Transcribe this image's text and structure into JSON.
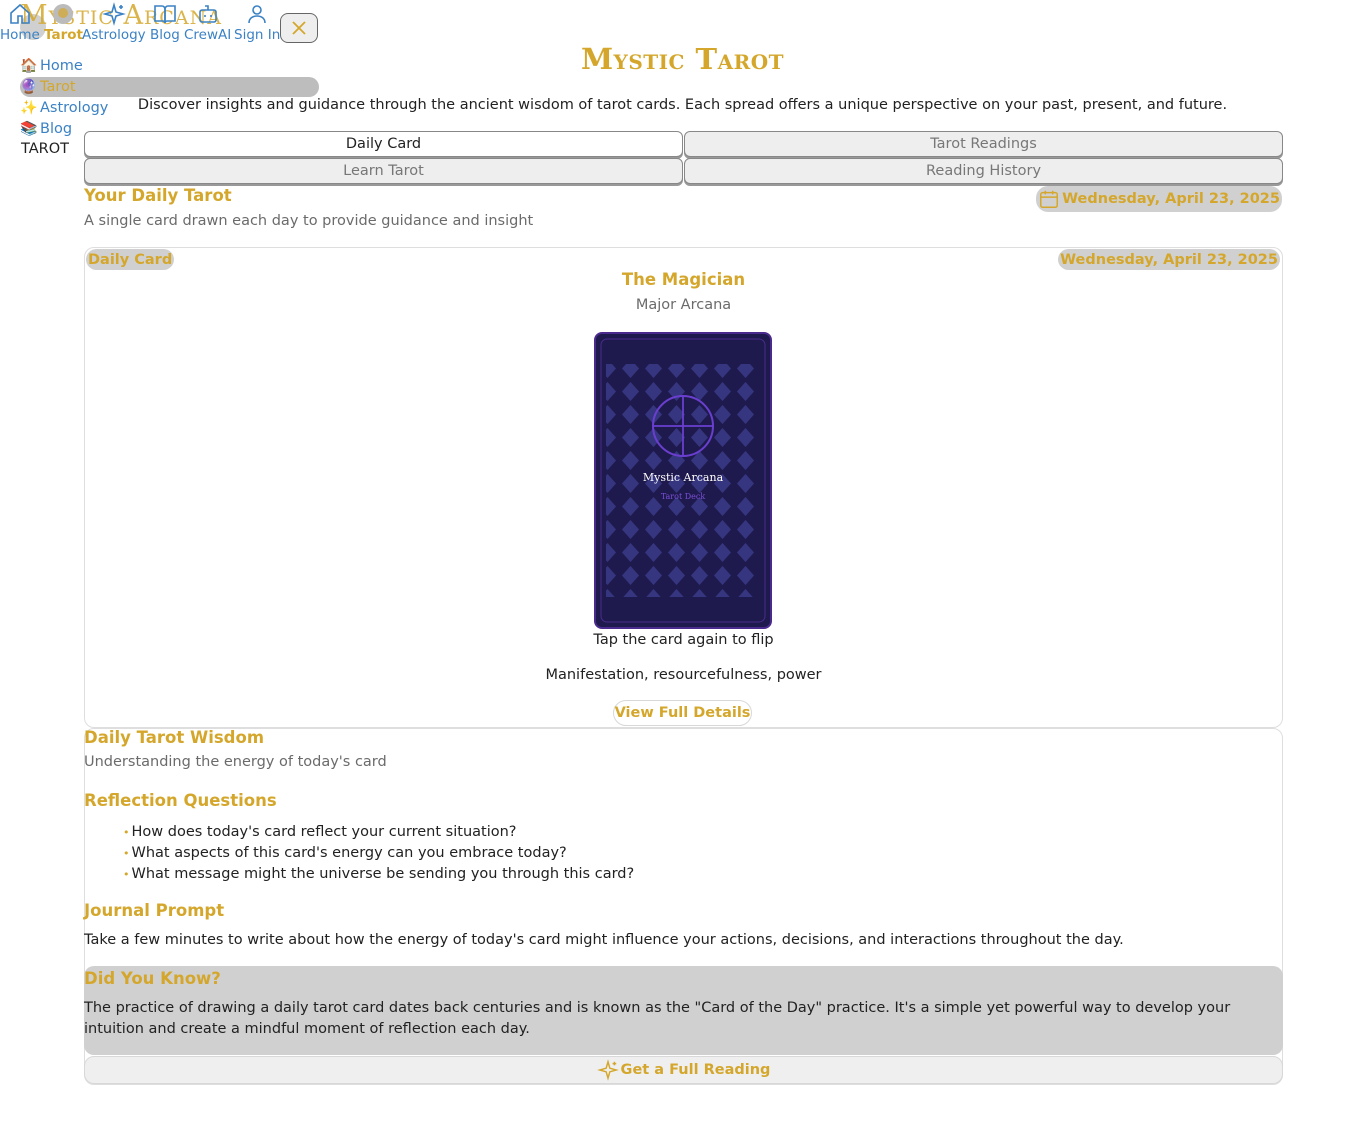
{
  "nav": {
    "logo": "Mystic Arcana",
    "items": [
      {
        "label": "Home",
        "icon": "home-icon"
      },
      {
        "label": "Tarot",
        "icon": "tarot-icon"
      },
      {
        "label": "Astrology",
        "icon": "sparkles-icon"
      },
      {
        "label": "Blog",
        "icon": "book-icon"
      },
      {
        "label": "CrewAI",
        "icon": "bot-icon"
      },
      {
        "label": "Sign In",
        "icon": "user-icon"
      }
    ]
  },
  "sidebar": {
    "items": [
      {
        "label": "Home",
        "emoji": "🏠"
      },
      {
        "label": "Tarot",
        "emoji": "🔮"
      },
      {
        "label": "Astrology",
        "emoji": "✨"
      },
      {
        "label": "Blog",
        "emoji": "📚"
      }
    ],
    "section_label": "TAROT"
  },
  "header": {
    "title": "Mystic Tarot",
    "subtitle": "Discover insights and guidance through the ancient wisdom of tarot cards. Each spread offers a unique perspective on your past, present, and future."
  },
  "tabs": [
    {
      "label": "Daily Card",
      "active": true
    },
    {
      "label": "Tarot Readings",
      "active": false
    },
    {
      "label": "Learn Tarot",
      "active": false
    },
    {
      "label": "Reading History",
      "active": false
    }
  ],
  "daily": {
    "title": "Your Daily Tarot",
    "description": "A single card drawn each day to provide guidance and insight",
    "date": "Wednesday, April 23, 2025",
    "card_pill": "Daily Card",
    "card_date": "Wednesday, April 23, 2025",
    "card_name": "The Magician",
    "card_arcana": "Major Arcana",
    "card_back_title": "Mystic Arcana",
    "card_back_subtitle": "Tarot Deck",
    "tap_hint": "Tap the card again to flip",
    "keywords": "Manifestation, resourcefulness, power",
    "details_button": "View Full Details"
  },
  "wisdom": {
    "title": "Daily Tarot Wisdom",
    "description": "Understanding the energy of today's card",
    "reflection_title": "Reflection Questions",
    "questions": [
      "How does today's card reflect your current situation?",
      "What aspects of this card's energy can you embrace today?",
      "What message might the universe be sending you through this card?"
    ],
    "journal_title": "Journal Prompt",
    "journal_text": "Take a few minutes to write about how the energy of today's card might influence your actions, decisions, and interactions throughout the day.",
    "know_title": "Did You Know?",
    "know_text": "The practice of drawing a daily tarot card dates back centuries and is known as the \"Card of the Day\" practice. It's a simple yet powerful way to develop your intuition and create a mindful moment of reflection each day.",
    "reading_button": "Get a Full Reading"
  },
  "colors": {
    "accent_gold": "#d4a72c",
    "link_blue": "#3b82c4",
    "card_navy": "#1f1a4d",
    "card_purple": "#6a3fd0"
  }
}
